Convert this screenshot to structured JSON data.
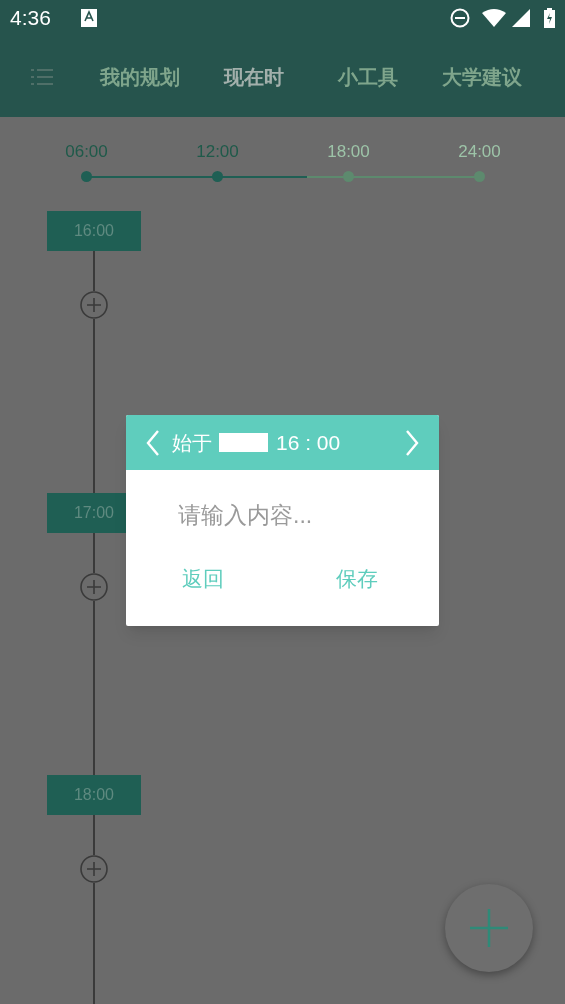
{
  "status_bar": {
    "time": "4:36"
  },
  "tabs": [
    {
      "label": "我的规划",
      "selected": false
    },
    {
      "label": "现在时",
      "selected": true
    },
    {
      "label": "小工具",
      "selected": false
    },
    {
      "label": "大学建议",
      "selected": false
    }
  ],
  "day_scale": {
    "level": 0.56,
    "ticks": [
      {
        "label": "06:00",
        "reached": true
      },
      {
        "label": "12:00",
        "reached": true
      },
      {
        "label": "18:00",
        "reached": false
      },
      {
        "label": "24:00",
        "reached": false
      }
    ]
  },
  "slots": [
    {
      "time": "16:00"
    },
    {
      "time": "17:00"
    },
    {
      "time": "18:00"
    }
  ],
  "dialog": {
    "prefix": "始于",
    "time": "16 : 00",
    "placeholder": "请输入内容...",
    "buttons": [
      "返回",
      "保存"
    ]
  }
}
